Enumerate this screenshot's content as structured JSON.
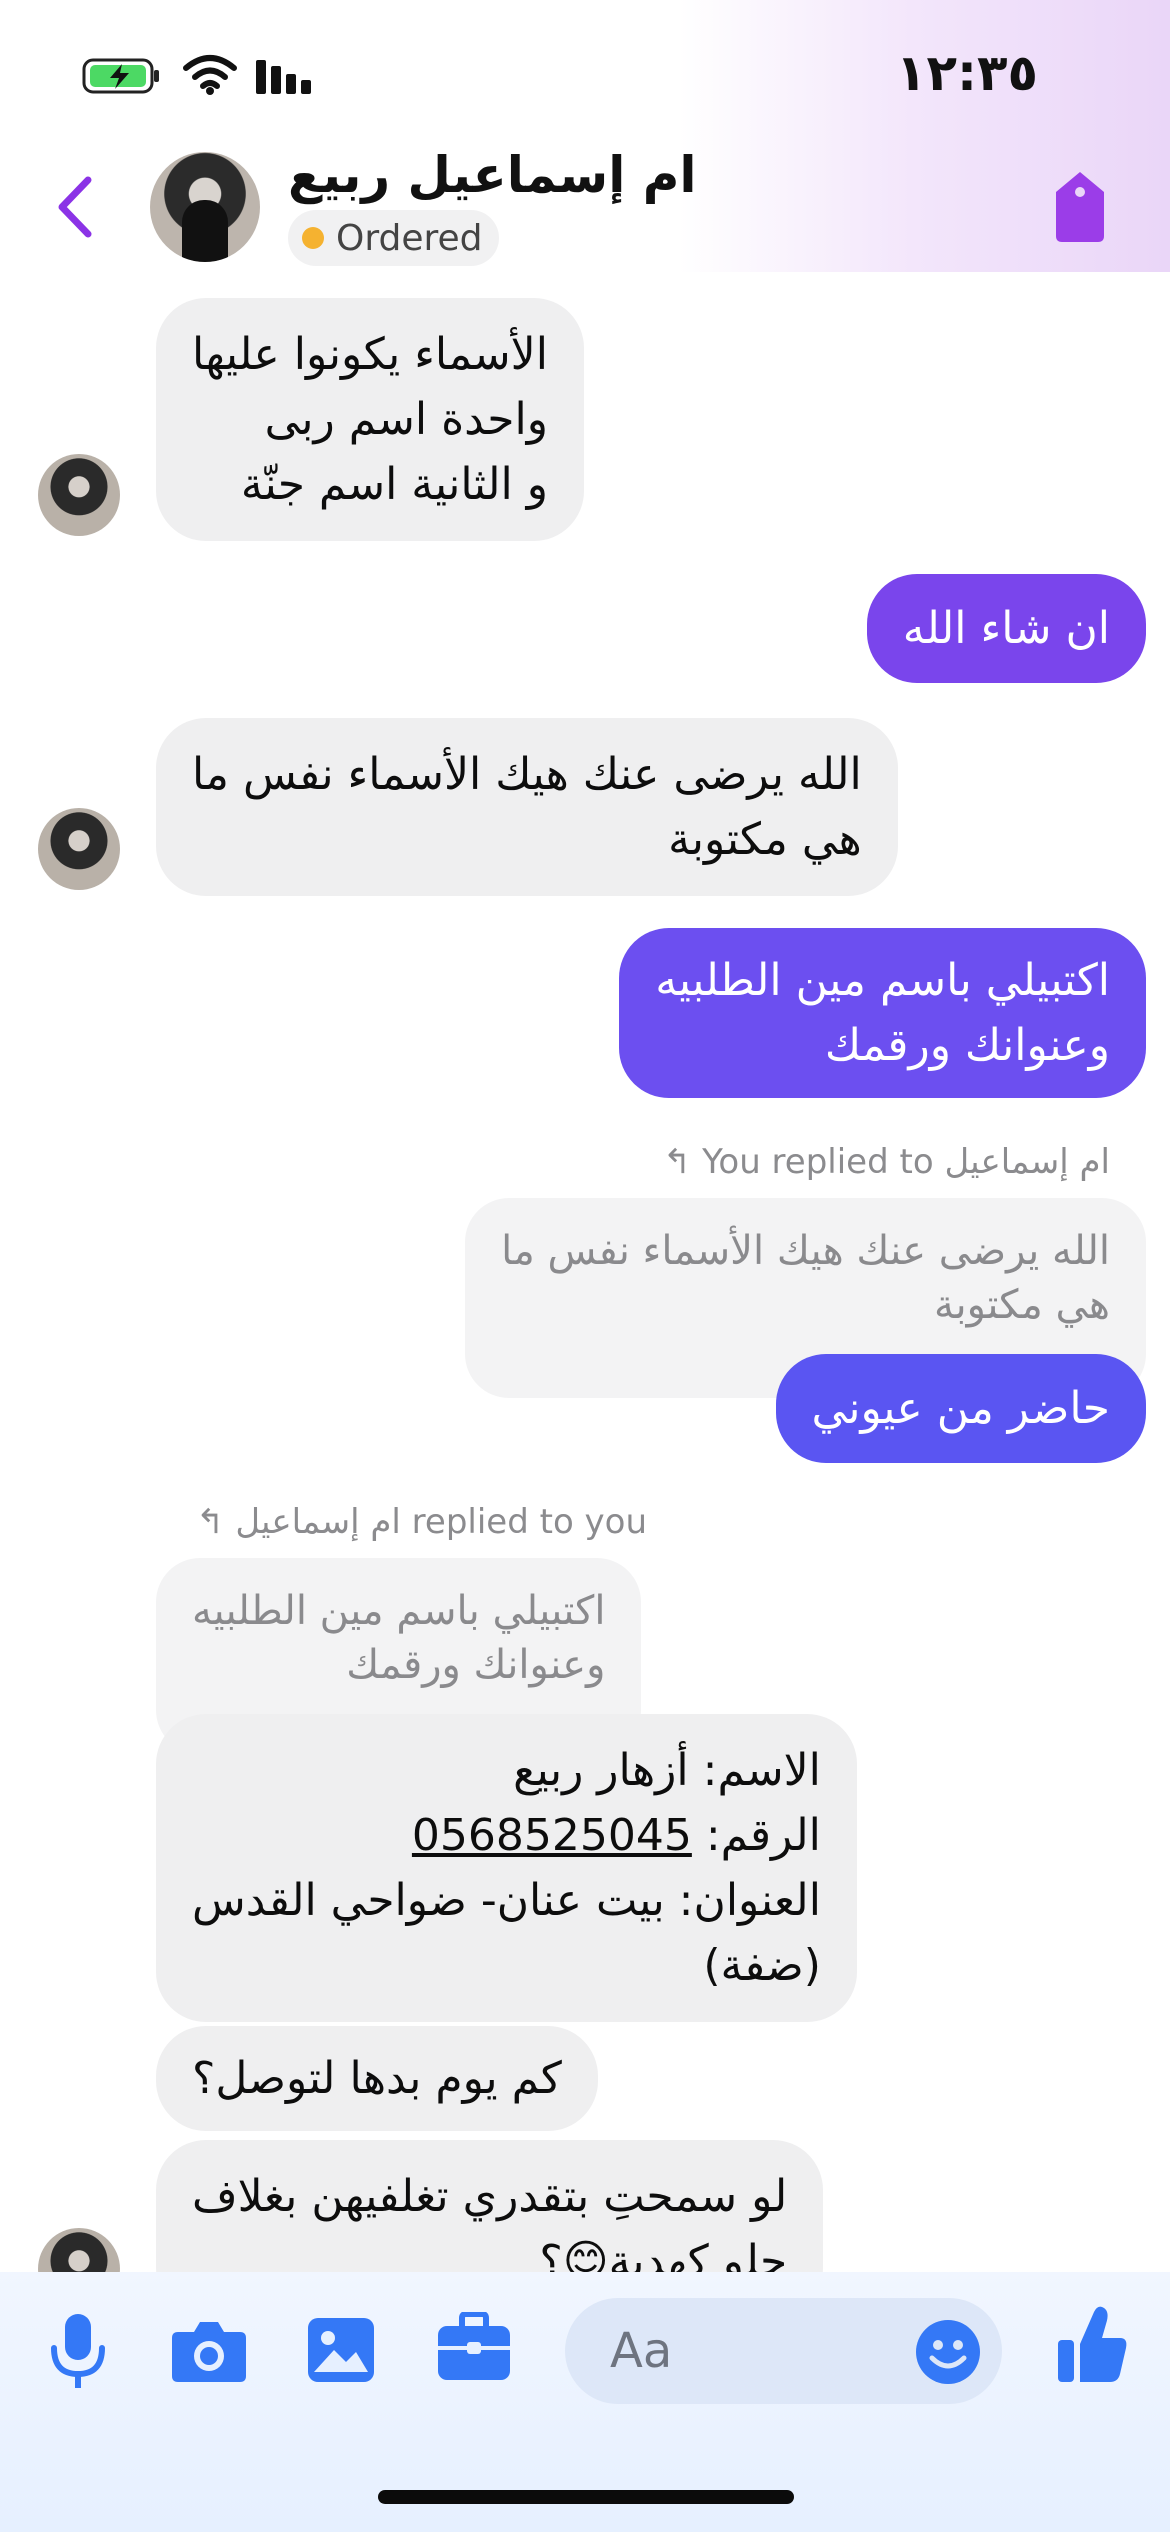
{
  "status_bar": {
    "time": "١٢:٣٥",
    "icons": [
      "battery-charging-icon",
      "wifi-icon",
      "signal-icon"
    ]
  },
  "header": {
    "contact_name": "ام إسماعيل ربيع",
    "status_label": "Ordered",
    "status_color": "#f5b230",
    "back_icon": "chevron-left-icon",
    "tag_icon": "tag-icon",
    "accent": "#8b33e6"
  },
  "messages": [
    {
      "sender": "contact",
      "lines": [
        "الأسماء يكونوا عليها",
        "واحدة اسم ربى",
        "و الثانية اسم جنّة"
      ]
    },
    {
      "sender": "me",
      "lines": [
        "ان شاء الله"
      ],
      "color": "#7a45ec"
    },
    {
      "sender": "contact",
      "lines": [
        "الله يرضى عنك هيك الأسماء نفس ما",
        "هي مكتوبة"
      ]
    },
    {
      "sender": "me",
      "lines": [
        "اكتبيلي باسم مين الطلبيه",
        "وعنوانك ورقمك"
      ],
      "color": "#6c4ff0"
    },
    {
      "sender": "me",
      "reply_meta": "You replied to ام إسماعيل",
      "quote_lines": [
        "الله يرضى عنك هيك الأسماء نفس ما",
        "هي مكتوبة"
      ],
      "lines": [
        "حاضر من عيوني"
      ],
      "color": "#5a55f2"
    },
    {
      "sender": "contact",
      "reply_meta": "ام إسماعيل replied to you",
      "quote_lines": [
        "اكتبيلي باسم مين الطلبيه",
        "وعنوانك ورقمك"
      ],
      "lines": [
        "الاسم: أزهار ربيع",
        "العنوان: بيت عنان- ضواحي القدس",
        "(ضفة)"
      ],
      "phone_label": "الرقم:",
      "phone": "0568525045"
    },
    {
      "sender": "contact",
      "lines": [
        "كم يوم بدها لتوصل؟"
      ]
    },
    {
      "sender": "contact",
      "lines": [
        "لو سمحتِ بتقدري تغلفيهن بغلاف",
        "حلو كهدية😊؟"
      ]
    }
  ],
  "composer": {
    "placeholder": "Aa",
    "icons": [
      "microphone-icon",
      "camera-icon",
      "image-icon",
      "briefcase-icon",
      "emoji-icon",
      "thumbs-up-icon"
    ],
    "icon_color": "#3478f6"
  }
}
